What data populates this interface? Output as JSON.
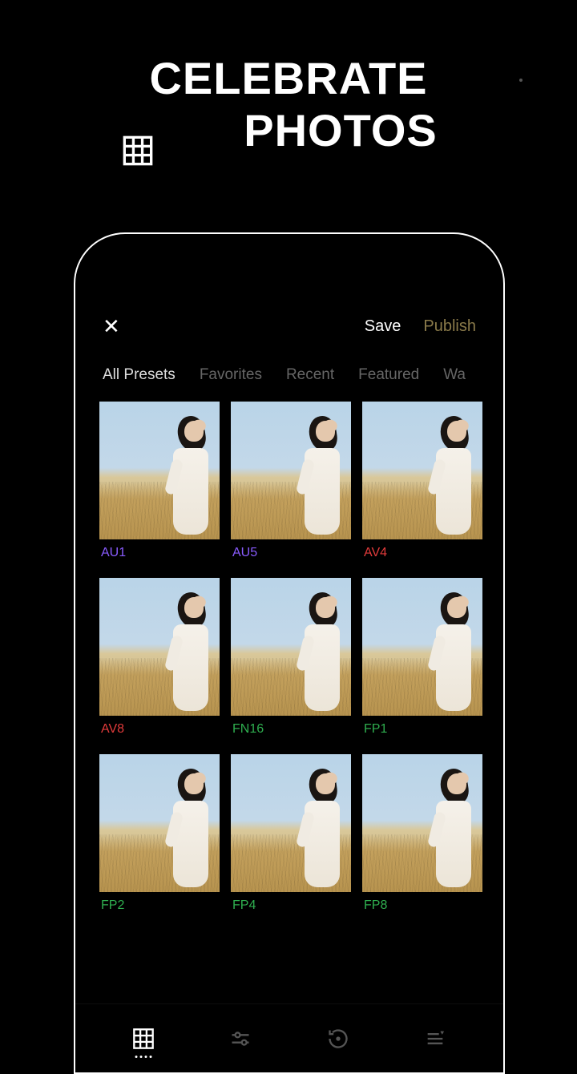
{
  "hero": {
    "line1": "CELEBRATE",
    "line2": "PHOTOS"
  },
  "topbar": {
    "close": "✕",
    "save": "Save",
    "publish": "Publish"
  },
  "tabs": [
    {
      "label": "All Presets",
      "active": true
    },
    {
      "label": "Favorites",
      "active": false
    },
    {
      "label": "Recent",
      "active": false
    },
    {
      "label": "Featured",
      "active": false
    },
    {
      "label": "Wa",
      "active": false
    }
  ],
  "presets": [
    [
      {
        "code": "AU1",
        "color": "purple"
      },
      {
        "code": "AU5",
        "color": "purple"
      },
      {
        "code": "AV4",
        "color": "red"
      }
    ],
    [
      {
        "code": "AV8",
        "color": "red"
      },
      {
        "code": "FN16",
        "color": "green"
      },
      {
        "code": "FP1",
        "color": "green"
      }
    ],
    [
      {
        "code": "FP2",
        "color": "green"
      },
      {
        "code": "FP4",
        "color": "green"
      },
      {
        "code": "FP8",
        "color": "green"
      }
    ]
  ],
  "bottombar": {
    "items": [
      "grid",
      "sliders",
      "history",
      "filters"
    ]
  }
}
